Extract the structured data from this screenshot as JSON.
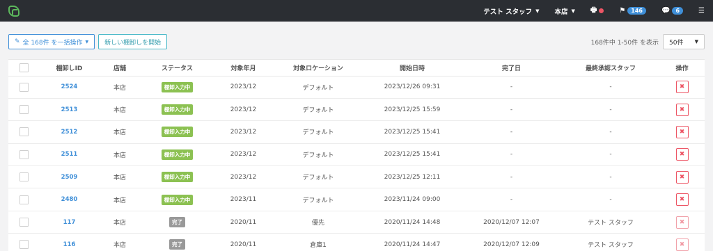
{
  "topbar": {
    "user_label": "テスト スタッフ",
    "store_label": "本店",
    "flag_count": "146",
    "comment_count": "6"
  },
  "toolbar": {
    "bulk_label": "全 168件 を一括操作",
    "new_label": "新しい棚卸しを開始",
    "count_text": "168件中 1-50件 を表示",
    "per_page": "50件"
  },
  "table": {
    "headers": [
      "棚卸しID",
      "店舗",
      "ステータス",
      "対象年月",
      "対象ロケーション",
      "開始日時",
      "完了日",
      "最終承認スタッフ",
      "操作"
    ],
    "rows": [
      {
        "id": "2524",
        "store": "本店",
        "status": "棚卸入力中",
        "status_color": "green",
        "month": "2023/12",
        "location": "デフォルト",
        "start": "2023/12/26 09:31",
        "done": "-",
        "staff": "-",
        "faded": false
      },
      {
        "id": "2513",
        "store": "本店",
        "status": "棚卸入力中",
        "status_color": "green",
        "month": "2023/12",
        "location": "デフォルト",
        "start": "2023/12/25 15:59",
        "done": "-",
        "staff": "-",
        "faded": false
      },
      {
        "id": "2512",
        "store": "本店",
        "status": "棚卸入力中",
        "status_color": "green",
        "month": "2023/12",
        "location": "デフォルト",
        "start": "2023/12/25 15:41",
        "done": "-",
        "staff": "-",
        "faded": false
      },
      {
        "id": "2511",
        "store": "本店",
        "status": "棚卸入力中",
        "status_color": "green",
        "month": "2023/12",
        "location": "デフォルト",
        "start": "2023/12/25 15:41",
        "done": "-",
        "staff": "-",
        "faded": false
      },
      {
        "id": "2509",
        "store": "本店",
        "status": "棚卸入力中",
        "status_color": "green",
        "month": "2023/12",
        "location": "デフォルト",
        "start": "2023/12/25 12:11",
        "done": "-",
        "staff": "-",
        "faded": false
      },
      {
        "id": "2480",
        "store": "本店",
        "status": "棚卸入力中",
        "status_color": "green",
        "month": "2023/11",
        "location": "デフォルト",
        "start": "2023/11/24 09:00",
        "done": "-",
        "staff": "-",
        "faded": false
      },
      {
        "id": "117",
        "store": "本店",
        "status": "完了",
        "status_color": "grey",
        "month": "2020/11",
        "location": "優先",
        "start": "2020/11/24 14:48",
        "done": "2020/12/07 12:07",
        "staff": "テスト スタッフ",
        "faded": true
      },
      {
        "id": "116",
        "store": "本店",
        "status": "完了",
        "status_color": "grey",
        "month": "2020/11",
        "location": "倉庫1",
        "start": "2020/11/24 14:47",
        "done": "2020/12/07 12:09",
        "staff": "テスト スタッフ",
        "faded": true
      }
    ]
  },
  "icons": {
    "logo": "app-logo-icon",
    "printer": "printer-icon",
    "flag": "flag-icon",
    "comment": "comment-icon",
    "menu": "hamburger-icon",
    "edit": "edit-icon",
    "delete": "delete-icon"
  },
  "colors": {
    "topbar_bg": "#2b2e33",
    "accent_blue": "#3f8fd8",
    "status_green": "#8cc152",
    "status_grey": "#999999",
    "danger_red": "#ed5565"
  }
}
